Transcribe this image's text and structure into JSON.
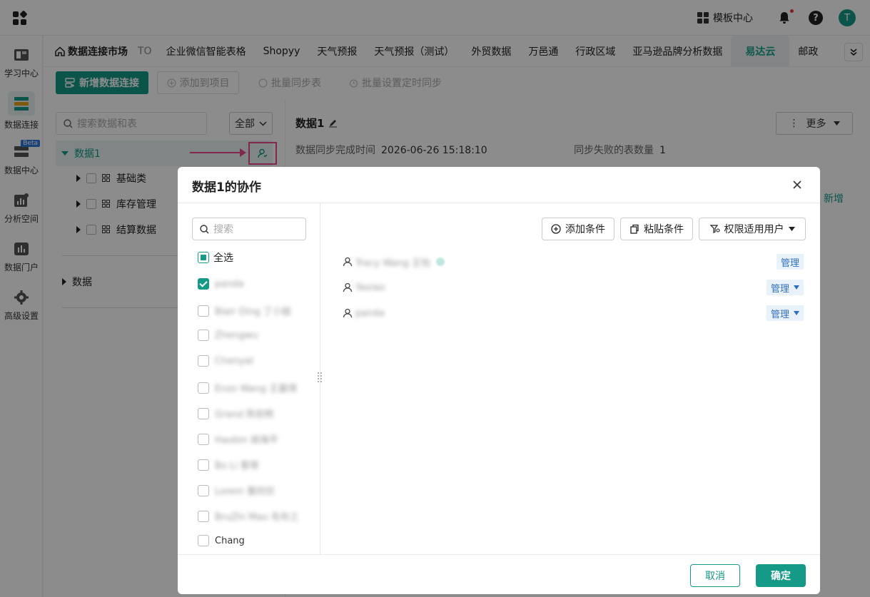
{
  "topbar": {
    "template_center": "模板中心",
    "help": "?",
    "avatar_initial": "T"
  },
  "nav": {
    "items": [
      {
        "label": "学习中心",
        "icon": "book-icon"
      },
      {
        "label": "数据连接",
        "icon": "data-connect-icon"
      },
      {
        "label": "数据中心",
        "icon": "data-center-icon",
        "badge": "Beta"
      },
      {
        "label": "分析空间",
        "icon": "analysis-icon"
      },
      {
        "label": "数据门户",
        "icon": "portal-icon"
      },
      {
        "label": "高级设置",
        "icon": "gear-icon"
      }
    ]
  },
  "tabs": {
    "first": "数据连接市场",
    "dim": "TO",
    "items": [
      "企业微信智能表格",
      "Shopyy",
      "天气预报",
      "天气预报（测试）",
      "外贸数据",
      "万邑通",
      "行政区域",
      "亚马逊品牌分析数据"
    ],
    "active": "易达云",
    "last": "邮政"
  },
  "toolbar": {
    "new_conn": "新增数据连接",
    "add_project": "添加到项目",
    "batch_sync": "批量同步表",
    "batch_timer": "批量设置定时同步"
  },
  "leftpanel": {
    "search_placeholder": "搜索数据和表",
    "filter": "全部",
    "root": "数据1",
    "children": [
      "基础类",
      "库存管理",
      "结算数据"
    ],
    "second_root": "数据"
  },
  "rightpanel": {
    "title": "数据1",
    "more": "更多",
    "sync_time_label": "数据同步完成时间",
    "sync_time_value": "2026-06-26 15:18:10",
    "fail_label": "同步失败的表数量",
    "fail_value": "1",
    "new_label": "新增"
  },
  "modal": {
    "title": "数据1的协作",
    "search_placeholder": "搜索",
    "select_all": "全选",
    "users": [
      {
        "name": "panda",
        "checked": true
      },
      {
        "name": "Blair Ding 丁小姐",
        "checked": false
      },
      {
        "name": "Zhengwu",
        "checked": false
      },
      {
        "name": "Chenyat",
        "checked": false
      },
      {
        "name": "Enzo Wang 王嘉琪",
        "checked": false
      },
      {
        "name": "Grand 陈前熊",
        "checked": false
      },
      {
        "name": "Haobin 胡海平",
        "checked": false
      },
      {
        "name": "Bo Li 黎哥",
        "checked": false
      },
      {
        "name": "Lorem 蕾欣欣",
        "checked": false
      },
      {
        "name": "BruZhi Mao 毛布之",
        "checked": false
      },
      {
        "name": "Chang",
        "checked": false
      }
    ],
    "add_condition": "添加条件",
    "paste_condition": "粘贴条件",
    "perm_users": "权限适用用户",
    "perms": [
      {
        "name": "Tracy Wang 王怡",
        "role": "管理",
        "dropdown": false
      },
      {
        "name": "Yaxiao",
        "role": "管理",
        "dropdown": true
      },
      {
        "name": "panda",
        "role": "管理",
        "dropdown": true
      }
    ],
    "cancel": "取消",
    "ok": "确定"
  }
}
